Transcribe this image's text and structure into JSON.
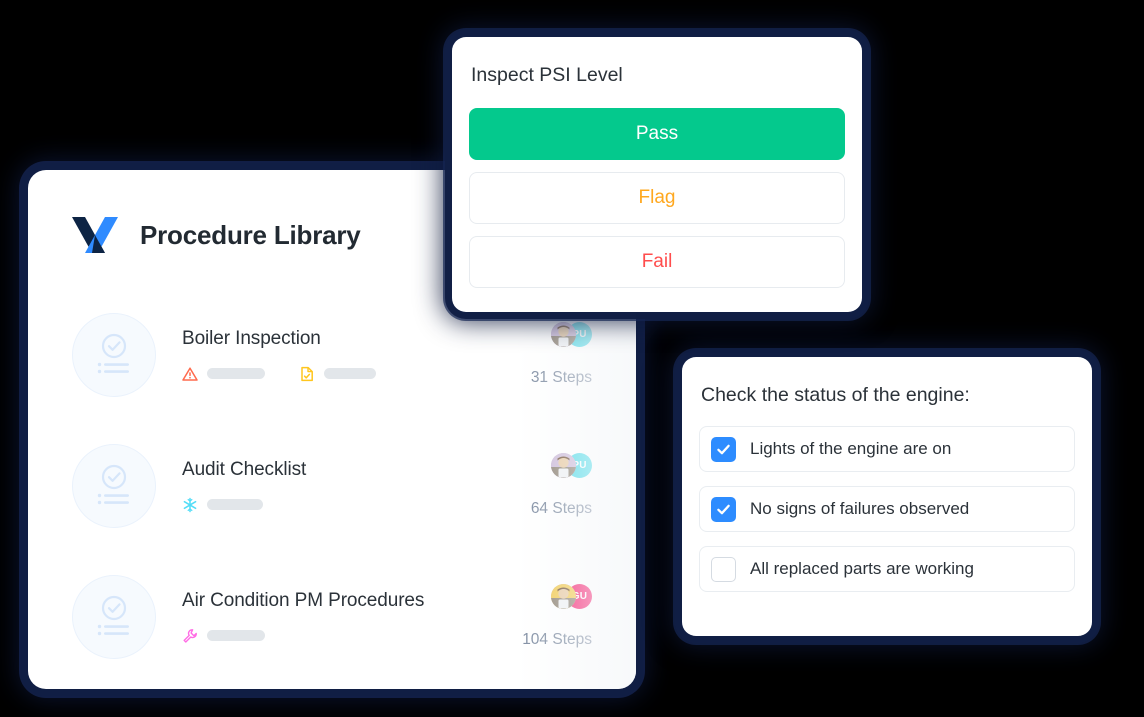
{
  "library": {
    "title": "Procedure Library",
    "logo_icon": "x-logo-icon",
    "logo_colors": {
      "dark": "#0d2444",
      "blue": "#2f8bff"
    },
    "items": [
      {
        "name": "Boiler Inspection",
        "steps": "31 Steps",
        "thumb_icon": "checklist-circle-icon",
        "tags": [
          {
            "icon": "warning-triangle-icon",
            "color": "#ff6a4d",
            "pill_width": "58"
          },
          {
            "icon": "document-check-icon",
            "color": "#ffc61e",
            "pill_width": "52"
          }
        ],
        "avatars": [
          {
            "type": "photo",
            "name": "user-photo-avatar"
          },
          {
            "type": "initials",
            "label": "PU",
            "color": "#4adbe8"
          }
        ]
      },
      {
        "name": "Audit Checklist",
        "steps": "64 Steps",
        "thumb_icon": "checklist-circle-icon",
        "tags": [
          {
            "icon": "snowflake-icon",
            "color": "#53ddf7",
            "pill_width": "56"
          }
        ],
        "avatars": [
          {
            "type": "photo",
            "name": "user-photo-avatar"
          },
          {
            "type": "initials",
            "label": "PU",
            "color": "#4adbe8"
          }
        ]
      },
      {
        "name": "Air Condition PM Procedures",
        "steps": "104 Steps",
        "thumb_icon": "checklist-circle-icon",
        "tags": [
          {
            "icon": "wrench-icon",
            "color": "#ff6de5",
            "pill_width": "58"
          }
        ],
        "avatars": [
          {
            "type": "photo",
            "name": "user-photo-avatar"
          },
          {
            "type": "initials",
            "label": "GU",
            "color": "#f6186b"
          }
        ]
      }
    ]
  },
  "psi_modal": {
    "title": "Inspect PSI Level",
    "options": [
      {
        "label": "Pass",
        "style": "primary",
        "color": "#04c98d"
      },
      {
        "label": "Flag",
        "style": "flag",
        "color": "#ffa81f"
      },
      {
        "label": "Fail",
        "style": "fail",
        "color": "#ff4d4d"
      }
    ]
  },
  "engine_card": {
    "title": "Check the status of the engine:",
    "checked_color": "#2d8cff",
    "items": [
      {
        "label": "Lights of the engine are on",
        "checked": true
      },
      {
        "label": "No signs of failures observed",
        "checked": true
      },
      {
        "label": "All replaced parts are working",
        "checked": false
      }
    ]
  }
}
